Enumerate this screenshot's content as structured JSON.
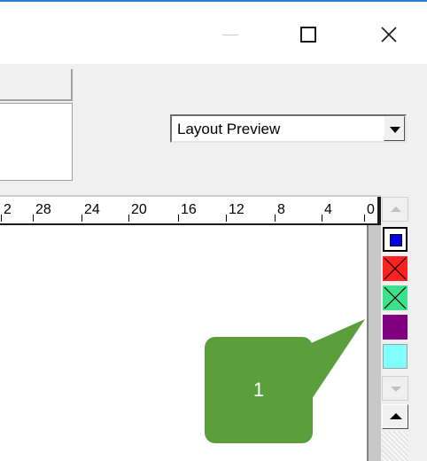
{
  "window": {
    "controls": {
      "minimize_icon": "minimize-icon",
      "maximize_icon": "maximize-icon",
      "close_icon": "close-icon"
    }
  },
  "view_select": {
    "value": "Layout Preview"
  },
  "ruler": {
    "labels": [
      "2",
      "28",
      "24",
      "20",
      "16",
      "12",
      "8",
      "4",
      "0"
    ]
  },
  "swatches": [
    {
      "name": "blue",
      "color": "#0000ee"
    },
    {
      "name": "red",
      "color": "#ff2020"
    },
    {
      "name": "green",
      "color": "#3ee08c"
    },
    {
      "name": "purple",
      "color": "#800080"
    },
    {
      "name": "cyan",
      "color": "#80ffff"
    }
  ],
  "callout": {
    "label": "1",
    "color": "#5b9e3c"
  }
}
